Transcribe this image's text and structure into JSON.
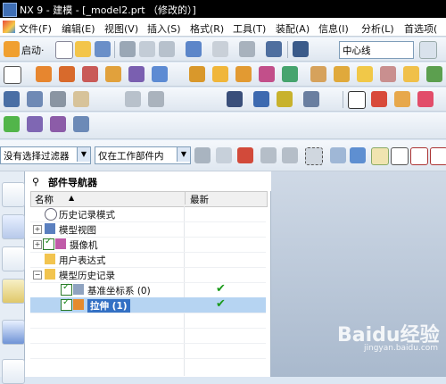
{
  "window": {
    "title": "NX 9 - 建模 - [_model2.prt （修改的）]"
  },
  "menu": {
    "items": [
      "文件(F)",
      "编辑(E)",
      "视图(V)",
      "插入(S)",
      "格式(R)",
      "工具(T)",
      "装配(A)",
      "信息(I)",
      "分析(L)",
      "首选项("
    ]
  },
  "toolbar": {
    "start_label": "启动·",
    "snap_value": "中心线"
  },
  "filterbar": {
    "filter_value": "没有选择过滤器",
    "scope_value": "仅在工作部件内"
  },
  "navigator": {
    "title": "部件导航器",
    "col_name": "名称",
    "col_latest": "最新",
    "rows": [
      {
        "label": "历史记录模式"
      },
      {
        "label": "模型视图"
      },
      {
        "label": "摄像机"
      },
      {
        "label": "用户表达式"
      },
      {
        "label": "模型历史记录"
      },
      {
        "label": "基准坐标系 (0)",
        "latest": "✔"
      },
      {
        "label": "拉伸 (1)",
        "latest": "✔"
      }
    ]
  },
  "watermark": {
    "text": "Baidu经验",
    "sub": "jingyan.baidu.com"
  },
  "colors": {
    "title_bar": "#000000",
    "selection": "#b6d4f2",
    "check": "#1a9a1a"
  }
}
